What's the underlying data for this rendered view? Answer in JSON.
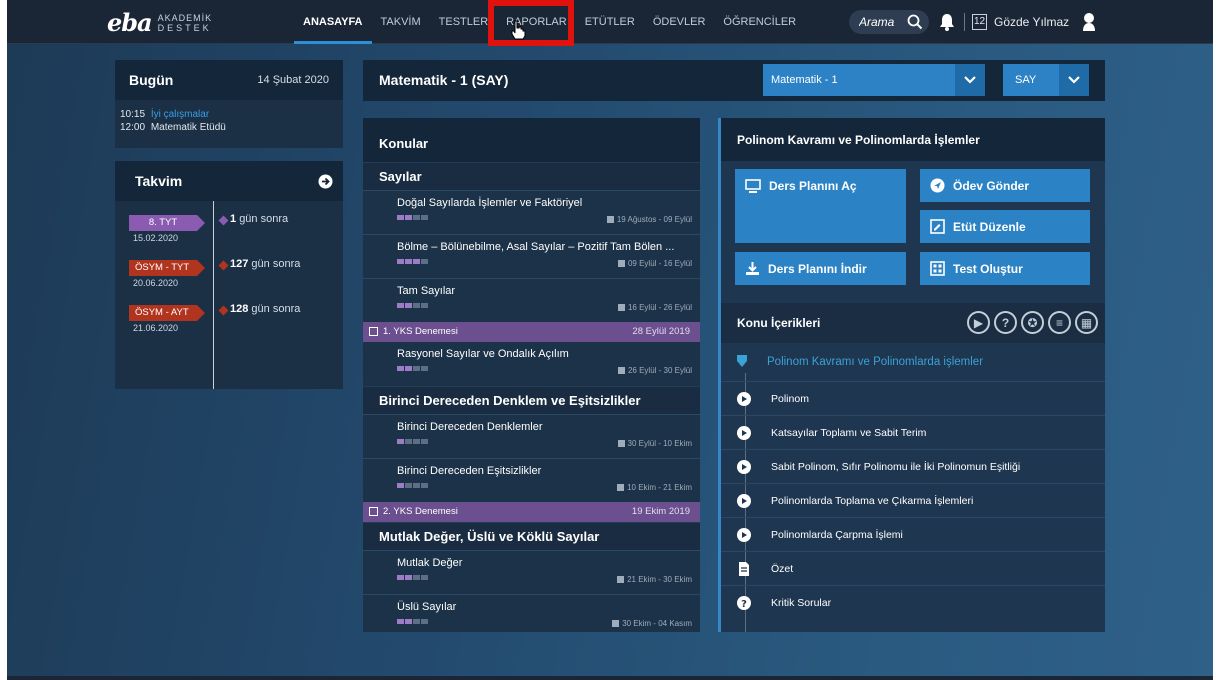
{
  "header": {
    "logo_main": "eba",
    "logo_sub1": "AKADEMİK",
    "logo_sub2": "DESTEK",
    "nav": [
      "ANASAYFA",
      "TAKVİM",
      "TESTLER",
      "RAPORLAR",
      "ETÜTLER",
      "ÖDEVLER",
      "ÖĞRENCİLER"
    ],
    "search_placeholder": "Arama",
    "calendar_badge": "12",
    "user_name": "Gözde Yılmaz"
  },
  "today": {
    "title": "Bugün",
    "date": "14 Şubat 2020",
    "items": [
      {
        "time": "10:15",
        "text": "İyi çalışmalar"
      },
      {
        "time": "12:00",
        "text": "Matematik Etüdü"
      }
    ]
  },
  "calendar": {
    "title": "Takvim",
    "events": [
      {
        "tag": "8. TYT",
        "date": "15.02.2020",
        "count": "1",
        "suffix": "gün sonra",
        "color": "#8a5bb1"
      },
      {
        "tag": "ÖSYM - TYT",
        "date": "20.06.2020",
        "count": "127",
        "suffix": "gün sonra",
        "color": "#b1341e"
      },
      {
        "tag": "ÖSYM - AYT",
        "date": "21.06.2020",
        "count": "128",
        "suffix": "gün sonra",
        "color": "#b1341e"
      }
    ]
  },
  "main": {
    "title": "Matematik - 1 (SAY)",
    "course_select": "Matematik - 1",
    "track_select": "SAY"
  },
  "topics": {
    "title": "Konular",
    "sections": [
      {
        "name": "Sayılar",
        "items": [
          {
            "name": "Doğal Sayılarda İşlemler ve Faktöriyel",
            "date": "19 Ağustos - 09 Eylül",
            "progress": 2
          },
          {
            "name": "Bölme – Bölünebilme, Asal Sayılar – Pozitif Tam Bölen ...",
            "date": "09 Eylül - 16 Eylül",
            "progress": 3
          },
          {
            "name": "Tam Sayılar",
            "date": "16 Eylül - 26 Eylül",
            "progress": 2
          }
        ]
      }
    ],
    "exam1": {
      "name": "1. YKS Denemesi",
      "date": "28 Eylül 2019"
    },
    "item_rasyonel": {
      "name": "Rasyonel Sayılar ve Ondalık Açılım",
      "date": "26 Eylül - 30 Eylül",
      "progress": 2
    },
    "section2": "Birinci Dereceden Denklem ve Eşitsizlikler",
    "item_denklem": {
      "name": "Birinci Dereceden Denklemler",
      "date": "30 Eylül - 10 Ekim",
      "progress": 1
    },
    "item_esitsizlik": {
      "name": "Birinci Dereceden Eşitsizlikler",
      "date": "10 Ekim - 21 Ekim",
      "progress": 1
    },
    "exam2": {
      "name": "2. YKS Denemesi",
      "date": "19 Ekim 2019"
    },
    "section3": "Mutlak Değer, Üslü ve Köklü Sayılar",
    "item_mutlak": {
      "name": "Mutlak Değer",
      "date": "21 Ekim - 30 Ekim",
      "progress": 2
    },
    "item_uslu": {
      "name": "Üslü Sayılar",
      "date": "30 Ekim - 04 Kasım",
      "progress": 2
    }
  },
  "detail": {
    "title": "Polinom Kavramı ve Polinomlarda İşlemler",
    "btn_open_plan": "Ders Planını Aç",
    "btn_send_hw": "Ödev Gönder",
    "btn_edit_etut": "Etüt Düzenle",
    "btn_download_plan": "Ders Planını İndir",
    "btn_create_test": "Test Oluştur",
    "contents_title": "Konu İçerikleri",
    "contents_main": "Polinom Kavramı ve Polinomlarda işlemler",
    "contents": [
      {
        "label": "Polinom",
        "icon": "play-icon"
      },
      {
        "label": "Katsayılar Toplamı ve Sabit Terim",
        "icon": "play-icon"
      },
      {
        "label": "Sabit Polinom, Sıfır Polinomu ile İki Polinomun Eşitliği",
        "icon": "play-icon"
      },
      {
        "label": "Polinomlarda Toplama ve Çıkarma İşlemleri",
        "icon": "play-icon"
      },
      {
        "label": "Polinomlarda Çarpma İşlemi",
        "icon": "play-icon"
      },
      {
        "label": "Özet",
        "icon": "document-icon"
      },
      {
        "label": "Kritik Sorular",
        "icon": "question-icon"
      }
    ]
  },
  "colors": {
    "accent": "#2b83c6",
    "highlight": "#e0120e",
    "exam": "#6b4f8e"
  }
}
